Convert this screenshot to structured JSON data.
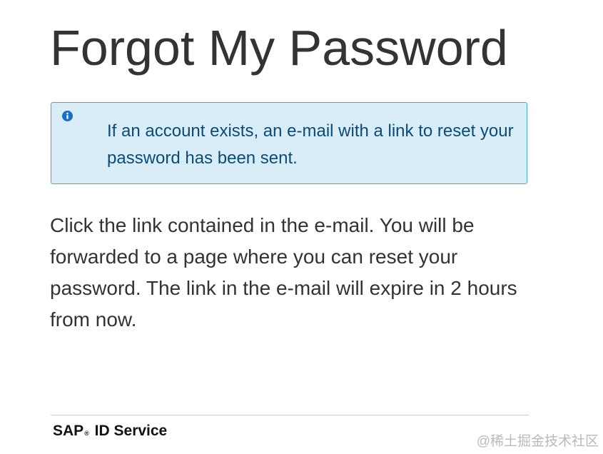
{
  "page": {
    "title": "Forgot My Password"
  },
  "alert": {
    "icon": "info-icon",
    "message": "If an account exists, an e-mail with a link to reset your password has been sent.",
    "color_bg": "#d9edf7",
    "color_border": "#3aaed8",
    "color_text": "#0a4b7a",
    "color_icon": "#1a6fc4"
  },
  "instructions": {
    "text": "Click the link contained in the e-mail. You will be forwarded to a page where you can reset your password. The link in the e-mail will expire in 2 hours from now."
  },
  "footer": {
    "brand_sap": "SAP",
    "brand_reg": "®",
    "brand_service": "ID Service"
  },
  "watermark": {
    "text": "@稀土掘金技术社区"
  }
}
